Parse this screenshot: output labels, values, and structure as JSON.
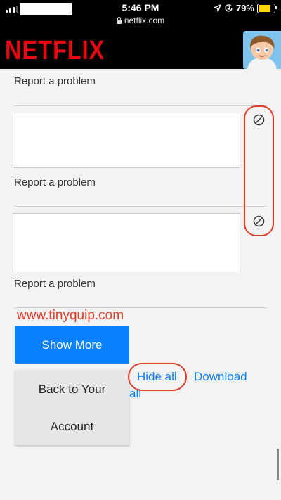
{
  "status": {
    "time": "5:46 PM",
    "url": "netflix.com",
    "battery": "79%",
    "battery_level": 0.79,
    "icons": [
      "signal-icon",
      "lock-icon",
      "location-icon",
      "orientation-lock-icon",
      "battery-icon"
    ]
  },
  "header": {
    "logo": "NETFLIX"
  },
  "items": [
    {
      "report_label": "Report a problem"
    },
    {
      "report_label": "Report a problem"
    },
    {
      "report_label": "Report a problem"
    }
  ],
  "watermark": "www.tinyquip.com",
  "actions": {
    "show_more": "Show More",
    "back_line1": "Back to Your",
    "back_line2": "Account",
    "hide_all": "Hide all",
    "download": "Download",
    "download_tail": "all"
  },
  "colors": {
    "netflix_red": "#e50914",
    "link_blue": "#0a80ff",
    "annotation_red": "#e33b27"
  }
}
